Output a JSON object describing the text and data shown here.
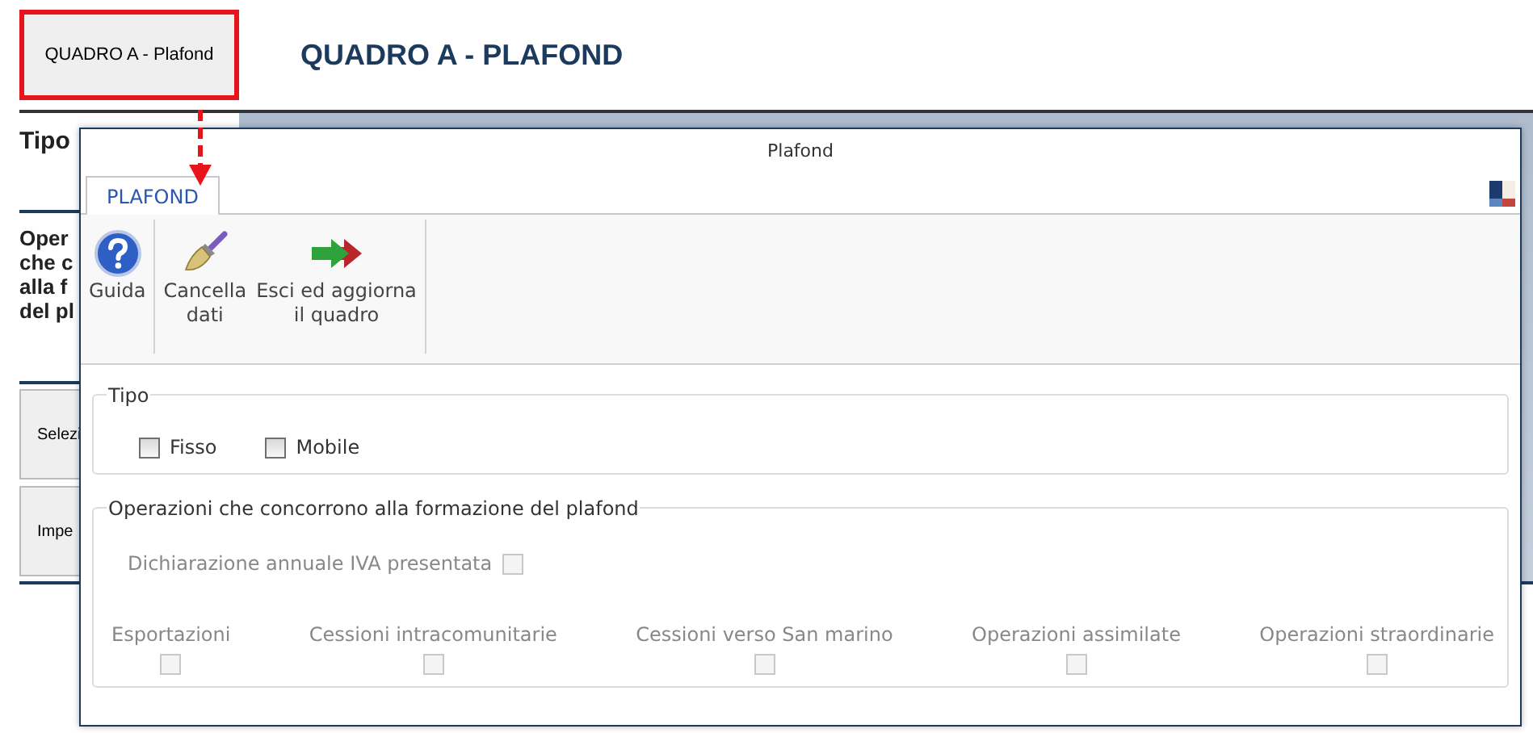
{
  "page": {
    "nav_button": {
      "label": "QUADRO A - Plafond",
      "highlighted": true
    },
    "title": "QUADRO A - PLAFOND",
    "section_1": "Tipo",
    "section_2": [
      "Oper",
      "che c",
      "alla f",
      "del pl"
    ],
    "buttons": [
      "Selezi",
      "Impe"
    ]
  },
  "dialog": {
    "title": "Plafond",
    "tabs": [
      {
        "label": "PLAFOND",
        "selected": true
      }
    ],
    "toolbar": [
      [
        {
          "kind": "help",
          "lines": [
            "Guida"
          ]
        }
      ],
      [
        {
          "kind": "broom",
          "lines": [
            "Cancella",
            "dati"
          ]
        },
        {
          "kind": "exit",
          "lines": [
            "Esci ed aggiorna",
            "il quadro"
          ]
        }
      ]
    ],
    "tipo": {
      "legend": "Tipo",
      "options": [
        {
          "label": "Fisso",
          "checked": false,
          "disabled": false
        },
        {
          "label": "Mobile",
          "checked": false,
          "disabled": false
        }
      ]
    },
    "operazioni": {
      "legend": "Operazioni che concorrono alla formazione del plafond",
      "declaration": {
        "label": "Dichiarazione annuale IVA presentata",
        "checked": false,
        "disabled": true
      },
      "columns": [
        {
          "label": "Esportazioni",
          "checked": false,
          "disabled": true
        },
        {
          "label": "Cessioni intracomunitarie",
          "checked": false,
          "disabled": true
        },
        {
          "label": "Cessioni verso San marino",
          "checked": false,
          "disabled": true
        },
        {
          "label": "Operazioni assimilate",
          "checked": false,
          "disabled": true
        },
        {
          "label": "Operazioni straordinarie",
          "checked": false,
          "disabled": true
        }
      ]
    }
  }
}
